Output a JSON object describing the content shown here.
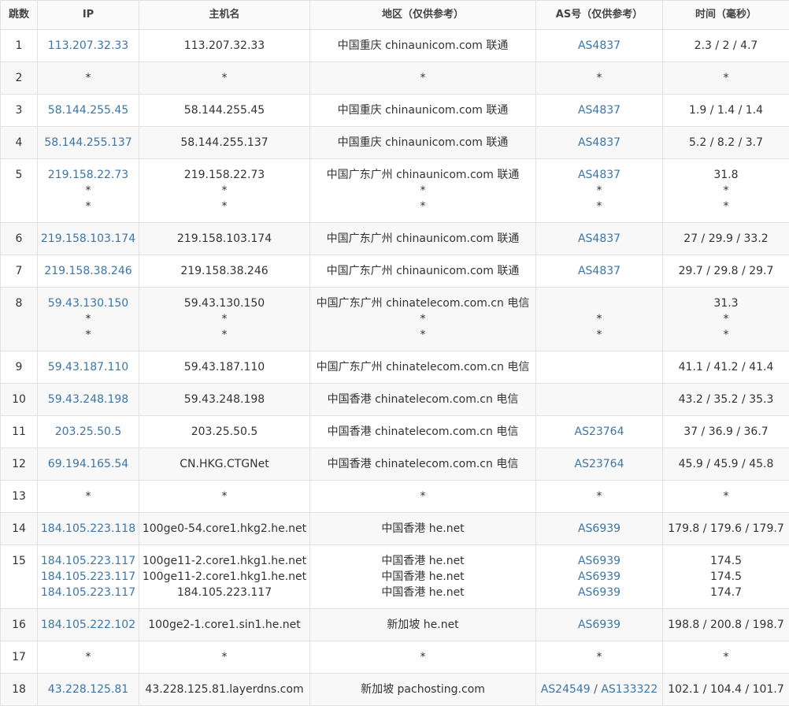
{
  "headers": [
    "跳数",
    "IP",
    "主机名",
    "地区（仅供参考）",
    "AS号（仅供参考）",
    "时间（毫秒）"
  ],
  "rows": [
    {
      "hop": "1",
      "ip": [
        "113.207.32.33"
      ],
      "host": [
        "113.207.32.33"
      ],
      "loc": [
        "中国重庆 chinaunicom.com 联通"
      ],
      "as": [
        [
          "AS4837"
        ]
      ],
      "time": [
        "2.3 / 2 / 4.7"
      ]
    },
    {
      "hop": "2",
      "ip": [
        "*"
      ],
      "host": [
        "*"
      ],
      "loc": [
        "*"
      ],
      "as": [
        [
          "*"
        ]
      ],
      "time": [
        "*"
      ]
    },
    {
      "hop": "3",
      "ip": [
        "58.144.255.45"
      ],
      "host": [
        "58.144.255.45"
      ],
      "loc": [
        "中国重庆 chinaunicom.com 联通"
      ],
      "as": [
        [
          "AS4837"
        ]
      ],
      "time": [
        "1.9 / 1.4 / 1.4"
      ]
    },
    {
      "hop": "4",
      "ip": [
        "58.144.255.137"
      ],
      "host": [
        "58.144.255.137"
      ],
      "loc": [
        "中国重庆 chinaunicom.com 联通"
      ],
      "as": [
        [
          "AS4837"
        ]
      ],
      "time": [
        "5.2 / 8.2 / 3.7"
      ]
    },
    {
      "hop": "5",
      "ip": [
        "219.158.22.73",
        "*",
        "*"
      ],
      "host": [
        "219.158.22.73",
        "*",
        "*"
      ],
      "loc": [
        "中国广东广州 chinaunicom.com 联通",
        "*",
        "*"
      ],
      "as": [
        [
          "AS4837"
        ],
        [
          "*"
        ],
        [
          "*"
        ]
      ],
      "time": [
        "31.8",
        "*",
        "*"
      ]
    },
    {
      "hop": "6",
      "ip": [
        "219.158.103.174"
      ],
      "host": [
        "219.158.103.174"
      ],
      "loc": [
        "中国广东广州 chinaunicom.com 联通"
      ],
      "as": [
        [
          "AS4837"
        ]
      ],
      "time": [
        "27 / 29.9 / 33.2"
      ]
    },
    {
      "hop": "7",
      "ip": [
        "219.158.38.246"
      ],
      "host": [
        "219.158.38.246"
      ],
      "loc": [
        "中国广东广州 chinaunicom.com 联通"
      ],
      "as": [
        [
          "AS4837"
        ]
      ],
      "time": [
        "29.7 / 29.8 / 29.7"
      ]
    },
    {
      "hop": "8",
      "ip": [
        "59.43.130.150",
        "*",
        "*"
      ],
      "host": [
        "59.43.130.150",
        "*",
        "*"
      ],
      "loc": [
        "中国广东广州 chinatelecom.com.cn 电信",
        "*",
        "*"
      ],
      "as": [
        [
          ""
        ],
        [
          "*"
        ],
        [
          "*"
        ]
      ],
      "time": [
        "31.3",
        "*",
        "*"
      ]
    },
    {
      "hop": "9",
      "ip": [
        "59.43.187.110"
      ],
      "host": [
        "59.43.187.110"
      ],
      "loc": [
        "中国广东广州 chinatelecom.com.cn 电信"
      ],
      "as": [
        [
          ""
        ]
      ],
      "time": [
        "41.1 / 41.2 / 41.4"
      ]
    },
    {
      "hop": "10",
      "ip": [
        "59.43.248.198"
      ],
      "host": [
        "59.43.248.198"
      ],
      "loc": [
        "中国香港 chinatelecom.com.cn 电信"
      ],
      "as": [
        [
          ""
        ]
      ],
      "time": [
        "43.2 / 35.2 / 35.3"
      ]
    },
    {
      "hop": "11",
      "ip": [
        "203.25.50.5"
      ],
      "host": [
        "203.25.50.5"
      ],
      "loc": [
        "中国香港 chinatelecom.com.cn 电信"
      ],
      "as": [
        [
          "AS23764"
        ]
      ],
      "time": [
        "37 / 36.9 / 36.7"
      ]
    },
    {
      "hop": "12",
      "ip": [
        "69.194.165.54"
      ],
      "host": [
        "CN.HKG.CTGNet"
      ],
      "loc": [
        "中国香港 chinatelecom.com.cn 电信"
      ],
      "as": [
        [
          "AS23764"
        ]
      ],
      "time": [
        "45.9 / 45.9 / 45.8"
      ]
    },
    {
      "hop": "13",
      "ip": [
        "*"
      ],
      "host": [
        "*"
      ],
      "loc": [
        "*"
      ],
      "as": [
        [
          "*"
        ]
      ],
      "time": [
        "*"
      ]
    },
    {
      "hop": "14",
      "ip": [
        "184.105.223.118"
      ],
      "host": [
        "100ge0-54.core1.hkg2.he.net"
      ],
      "loc": [
        "中国香港 he.net"
      ],
      "as": [
        [
          "AS6939"
        ]
      ],
      "time": [
        "179.8 / 179.6 / 179.7"
      ]
    },
    {
      "hop": "15",
      "ip": [
        "184.105.223.117",
        "184.105.223.117",
        "184.105.223.117"
      ],
      "host": [
        "100ge11-2.core1.hkg1.he.net",
        "100ge11-2.core1.hkg1.he.net",
        "184.105.223.117"
      ],
      "loc": [
        "中国香港 he.net",
        "中国香港 he.net",
        "中国香港 he.net"
      ],
      "as": [
        [
          "AS6939"
        ],
        [
          "AS6939"
        ],
        [
          "AS6939"
        ]
      ],
      "time": [
        "174.5",
        "174.5",
        "174.7"
      ]
    },
    {
      "hop": "16",
      "ip": [
        "184.105.222.102"
      ],
      "host": [
        "100ge2-1.core1.sin1.he.net"
      ],
      "loc": [
        "新加坡 he.net"
      ],
      "as": [
        [
          "AS6939"
        ]
      ],
      "time": [
        "198.8 / 200.8 / 198.7"
      ]
    },
    {
      "hop": "17",
      "ip": [
        "*"
      ],
      "host": [
        "*"
      ],
      "loc": [
        "*"
      ],
      "as": [
        [
          "*"
        ]
      ],
      "time": [
        "*"
      ]
    },
    {
      "hop": "18",
      "ip": [
        "43.228.125.81"
      ],
      "host": [
        "43.228.125.81.layerdns.com"
      ],
      "loc": [
        "新加坡 pachosting.com"
      ],
      "as": [
        [
          "AS24549",
          "AS133322"
        ]
      ],
      "time": [
        "102.1 / 104.4 / 101.7"
      ]
    }
  ]
}
